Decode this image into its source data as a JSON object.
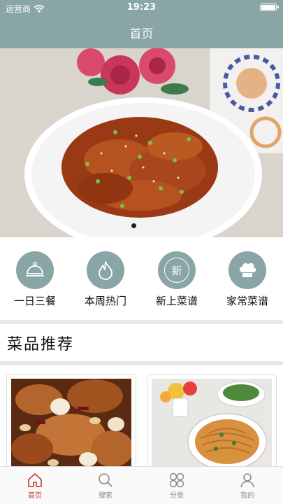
{
  "status_bar": {
    "carrier": "运营商",
    "time": "19:23"
  },
  "nav": {
    "title": "首页"
  },
  "banner": {
    "page_count": 1,
    "active_page": 1
  },
  "categories": [
    {
      "label": "一日三餐",
      "icon": "food-cover-icon"
    },
    {
      "label": "本周热门",
      "icon": "flame-icon"
    },
    {
      "label": "新上菜谱",
      "icon": "new-badge-icon",
      "icon_text": "新"
    },
    {
      "label": "家常菜谱",
      "icon": "chef-hat-icon"
    }
  ],
  "section": {
    "title": "菜品推荐"
  },
  "recipes": [
    {
      "name": "kung-pao-chicken",
      "image": "kung-pao-chicken-photo"
    },
    {
      "name": "noodles",
      "image": "noodles-photo"
    }
  ],
  "tabbar": {
    "items": [
      {
        "label": "首页",
        "icon": "home-icon",
        "active": true
      },
      {
        "label": "搜索",
        "icon": "search-icon",
        "active": false
      },
      {
        "label": "分类",
        "icon": "category-icon",
        "active": false
      },
      {
        "label": "我的",
        "icon": "user-icon",
        "active": false
      }
    ]
  },
  "colors": {
    "theme": "#8aa5a5",
    "active_tab": "#c0392b",
    "inactive_tab": "#8a8a8a"
  }
}
